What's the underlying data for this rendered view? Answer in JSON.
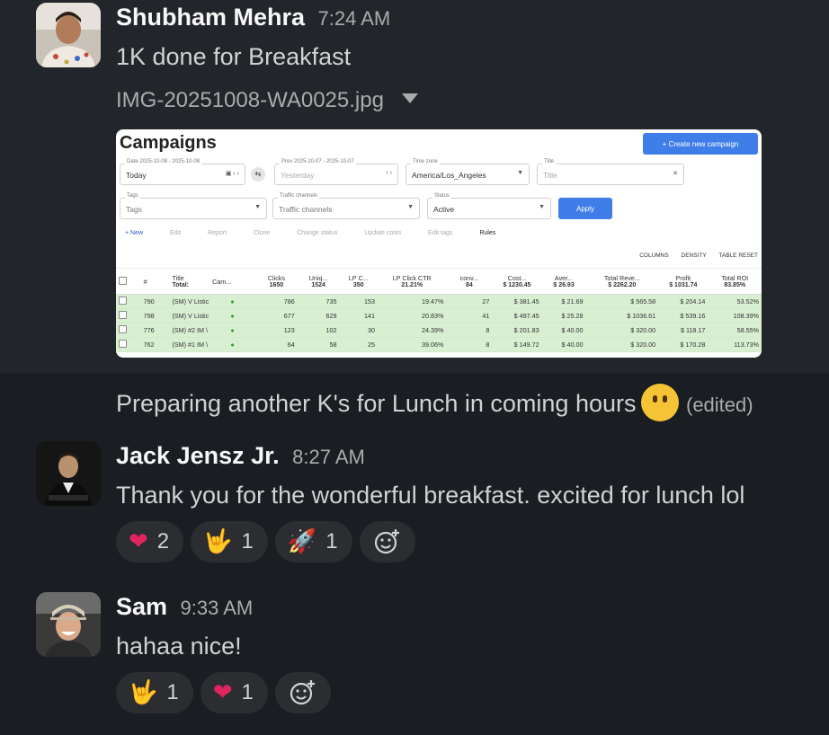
{
  "messages": [
    {
      "sender": "Shubham Mehra",
      "time": "7:24 AM",
      "text": "1K done for Breakfast",
      "attachment": {
        "filename": "IMG-20251008-WA0025.jpg",
        "screenshot": {
          "title": "Campaigns",
          "create_button": "+ Create new campaign",
          "filters": {
            "date": {
              "label": "Date 2025-10-08 - 2025-10-08",
              "value": "Today"
            },
            "prev": {
              "label": "Prev 2025-10-07 - 2025-10-07",
              "value": "Yesterday"
            },
            "timezone": {
              "label": "Time zone",
              "value": "America/Los_Angeles"
            },
            "title": {
              "label": "Title",
              "placeholder": "Title"
            },
            "tags": {
              "label": "Tags",
              "value": "Tags"
            },
            "traffic": {
              "label": "Traffic channels",
              "value": "Traffic channels"
            },
            "status": {
              "label": "Status",
              "value": "Active"
            }
          },
          "apply": "Apply",
          "toolbar": [
            "+ New",
            "Edit",
            "Report",
            "Clone",
            "Change status",
            "Update costs",
            "Edit tags",
            "Rules"
          ],
          "columns_bar": [
            "COLUMNS",
            "DENSITY",
            "TABLE RESET"
          ],
          "table": {
            "headers": [
              "#",
              "Title",
              "Cam...",
              "Clicks",
              "Uniq...",
              "LP C...",
              "LP Click CTR",
              "conv...",
              "Cost...",
              "Aver...",
              "Total Reve...",
              "Profit",
              "Total ROI"
            ],
            "totals": [
              "",
              "Total:",
              "",
              "1650",
              "1524",
              "350",
              "21.21%",
              "84",
              "$ 1230.45",
              "$ 26.93",
              "$ 2262.20",
              "$ 1031.74",
              "83.85%"
            ],
            "rows": [
              [
                "790",
                "(SM) V Listic",
                "●",
                "786",
                "735",
                "153",
                "19.47%",
                "27",
                "$ 381.45",
                "$ 21.69",
                "$ 565.58",
                "$ 204.14",
                "53.52%"
              ],
              [
                "798",
                "(SM) V Listic",
                "●",
                "677",
                "629",
                "141",
                "20.83%",
                "41",
                "$ 497.45",
                "$ 25.28",
                "$ 1036.61",
                "$ 539.16",
                "108.39%"
              ],
              [
                "776",
                "(SM) #2 IM \\",
                "●",
                "123",
                "102",
                "30",
                "24.39%",
                "8",
                "$ 201.83",
                "$ 40.00",
                "$ 320.00",
                "$ 118.17",
                "58.55%"
              ],
              [
                "762",
                "(SM) #1 IM \\",
                "●",
                "64",
                "58",
                "25",
                "39.06%",
                "8",
                "$ 149.72",
                "$ 40.00",
                "$ 320.00",
                "$ 170.28",
                "113.73%"
              ]
            ]
          }
        }
      },
      "followup": "Preparing another K's for Lunch in coming hours",
      "edited": "(edited)"
    },
    {
      "sender": "Jack Jensz Jr.",
      "time": "8:27 AM",
      "text": "Thank you for the wonderful breakfast. excited for lunch lol",
      "reactions": [
        {
          "emoji": "❤️",
          "count": "2"
        },
        {
          "emoji": "🤟",
          "count": "1"
        },
        {
          "emoji": "🚀",
          "count": "1"
        }
      ]
    },
    {
      "sender": "Sam",
      "time": "9:33 AM",
      "text": "hahaa nice!",
      "reactions": [
        {
          "emoji": "🤟",
          "count": "1"
        },
        {
          "emoji": "❤️",
          "count": "1"
        }
      ]
    }
  ],
  "colors": {
    "background": "#1a1d21",
    "highlight": "#222529",
    "reaction_bg": "#2b2d31",
    "accent": "#3f7de8"
  }
}
